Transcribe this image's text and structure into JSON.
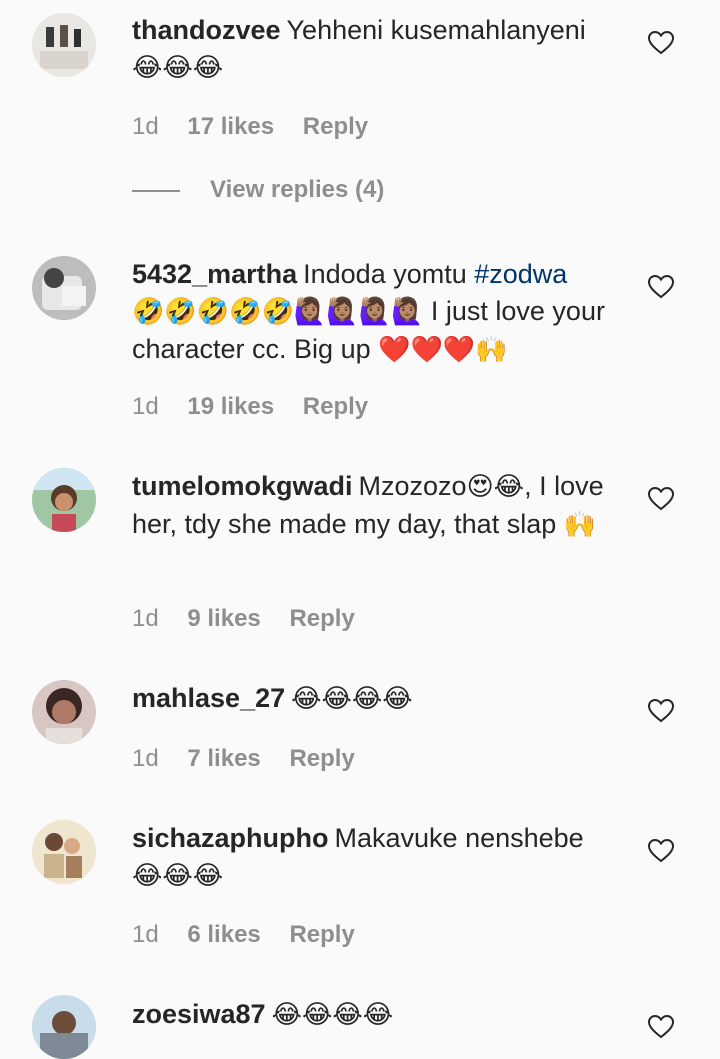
{
  "comments": [
    {
      "username": "thandozvee",
      "text_before": "Yehheni kusemahlanyeni",
      "emoji_after": "😂😂😂",
      "time": "1d",
      "likes": "17 likes",
      "reply": "Reply",
      "view_replies": "View replies (4)"
    },
    {
      "username": "5432_martha",
      "text_before": "Indoda yomtu",
      "hashtag": "#zodwa",
      "emoji_mid": "🤣🤣🤣🤣🤣🙋🏽‍♀️🙋🏽‍♀️🙋🏽‍♀️🙋🏽‍♀️",
      "text_after": "I just love your character cc. Big up",
      "emoji_after": "❤️❤️❤️🙌",
      "time": "1d",
      "likes": "19 likes",
      "reply": "Reply"
    },
    {
      "username": "tumelomokgwadi",
      "text_before": "Mzozozo",
      "emoji_mid": "😍😂",
      "text_after": ", I love her, tdy she made my day, that slap",
      "emoji_after": "🙌",
      "time": "1d",
      "likes": "9 likes",
      "reply": "Reply"
    },
    {
      "username": "mahlase_27",
      "emoji_after": "😂😂😂😂",
      "time": "1d",
      "likes": "7 likes",
      "reply": "Reply"
    },
    {
      "username": "sichazaphupho",
      "text_before": "Makavuke nenshebe",
      "emoji_after": "😂😂😂",
      "time": "1d",
      "likes": "6 likes",
      "reply": "Reply"
    },
    {
      "username": "zoesiwa87",
      "emoji_after": "😂😂😂😂"
    }
  ],
  "colors": {
    "text": "#262626",
    "meta": "#8e8e8e",
    "hashtag": "#003569",
    "background": "#fafafa"
  },
  "icons": {
    "like": "heart-outline-icon"
  }
}
